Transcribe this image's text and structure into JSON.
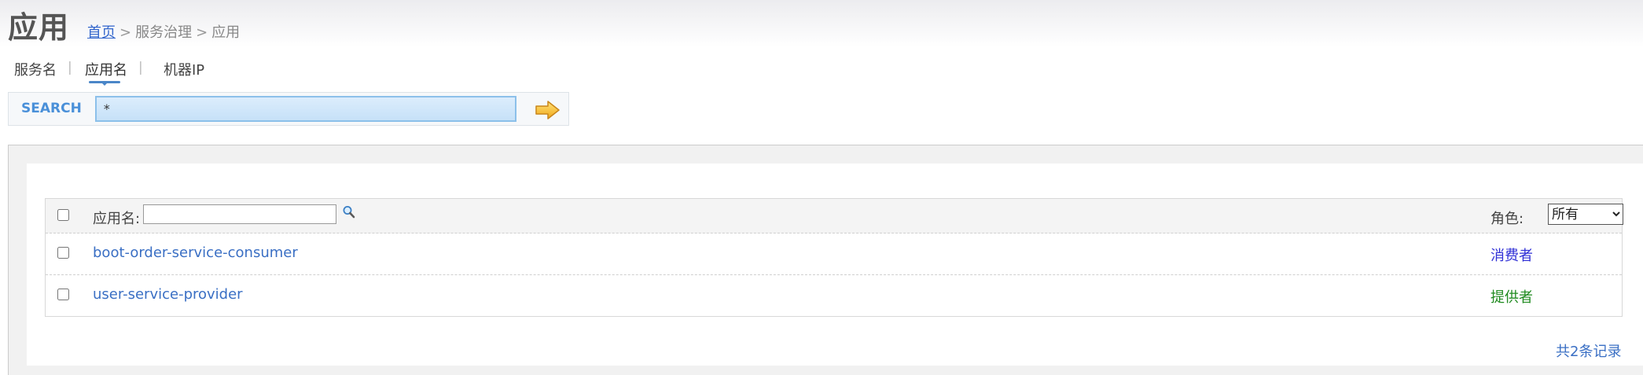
{
  "header": {
    "title": "应用",
    "breadcrumb": {
      "home": "首页",
      "sep": ">",
      "section": "服务治理",
      "current": "应用"
    }
  },
  "tabs": [
    {
      "label": "服务名"
    },
    {
      "label": "应用名",
      "active": true
    },
    {
      "label": "机器IP"
    }
  ],
  "tab_separator": "|",
  "search": {
    "label": "SEARCH",
    "value": "*"
  },
  "grid": {
    "header": {
      "filter_label": "应用名:",
      "filter_value": "",
      "role_label": "角色:",
      "role_selected": "所有"
    },
    "rows": [
      {
        "name": "boot-order-service-consumer",
        "role": "消费者",
        "role_color": "#2f2fd6"
      },
      {
        "name": "user-service-provider",
        "role": "提供者",
        "role_color": "#1f8a1f"
      }
    ]
  },
  "footer": {
    "record_count_text": "共2条记录"
  },
  "colors": {
    "link": "#3a6fc4",
    "accent": "#4a90d9",
    "search_bg": "#c6e1f8"
  },
  "icons": {
    "search_go": "arrow-right-icon",
    "filter": "magnifier-icon"
  }
}
